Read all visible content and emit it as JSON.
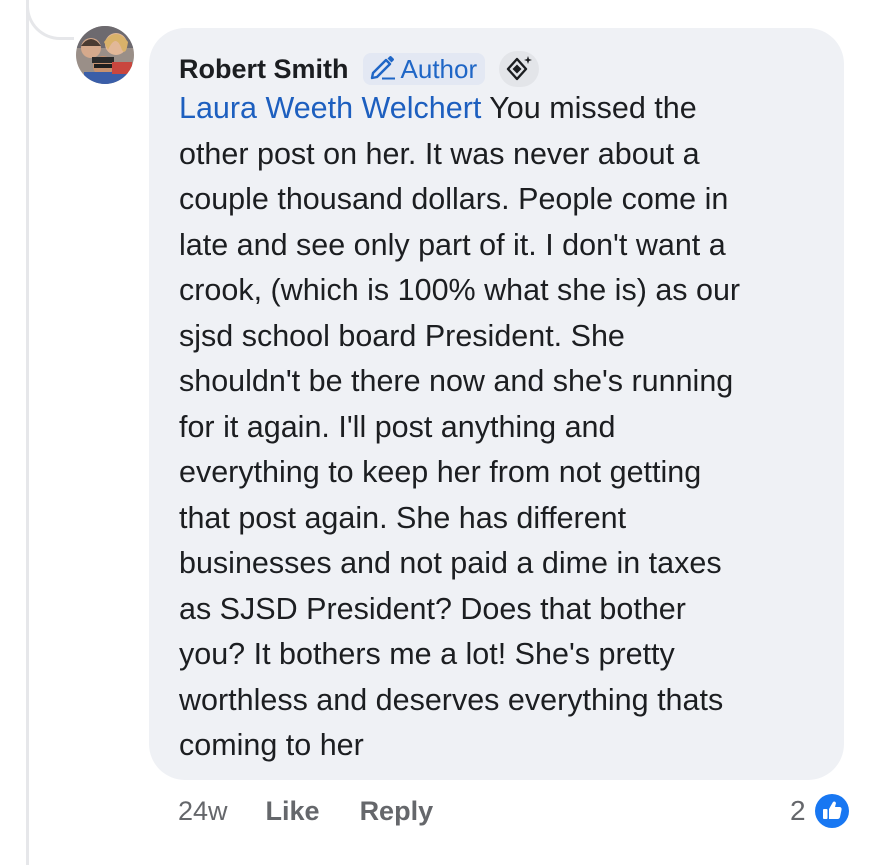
{
  "comment": {
    "author": "Robert Smith",
    "badge_label": "Author",
    "mention": "Laura Weeth Welchert",
    "text": " You missed the\nother post on her. It was never about a\ncouple thousand dollars. People come in\nlate and see only part of it. I don't want a\ncrook, (which is 100% what she is) as our\nsjsd school board President. She\nshouldn't be there now and she's running\nfor it again. I'll post anything and\neverything to keep her from not getting\nthat post again. She has different\nbusinesses and  not paid a dime in taxes\nas SJSD President? Does that bother\nyou? It bothers me a lot! She's pretty\nworthless and deserves everything thats\ncoming to her"
  },
  "footer": {
    "time": "24w",
    "like_label": "Like",
    "reply_label": "Reply",
    "reaction_count": "2"
  },
  "icons": {
    "author_badge": "pencil-icon",
    "moderator": "sparkle-diamond-icon",
    "reaction": "thumbs-up-icon"
  },
  "colors": {
    "mention": "#1d5fbf",
    "bubble_bg": "#eff1f5",
    "like_reaction": "#1877f2"
  }
}
